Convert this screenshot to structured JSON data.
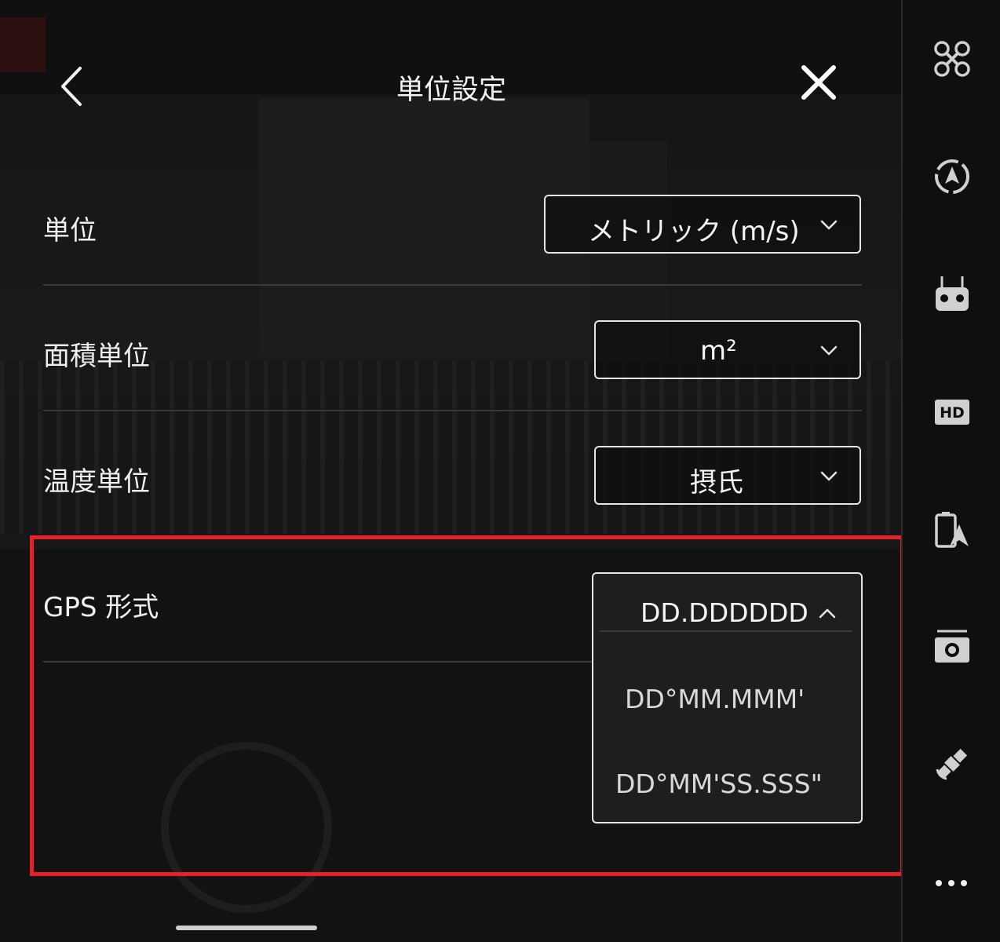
{
  "header": {
    "title": "単位設定",
    "back_icon": "chevron-left-icon",
    "close_icon": "close-icon"
  },
  "settings": {
    "units": {
      "label": "単位",
      "value": "メトリック (m/s)"
    },
    "area_units": {
      "label": "面積単位",
      "value": "m²"
    },
    "temperature_units": {
      "label": "温度単位",
      "value": "摂氏"
    },
    "gps_format": {
      "label": "GPS 形式",
      "selected": "DD.DDDDDD",
      "options": [
        "DD°MM.MMM'",
        "DD°MM'SS.SSS\""
      ]
    }
  },
  "sidebar": {
    "icons": [
      "drone-icon",
      "navigation-icon",
      "remote-controller-icon",
      "hd-icon",
      "battery-icon",
      "camera-icon",
      "satellite-icon",
      "more-icon"
    ],
    "hd_label": "HD"
  },
  "colors": {
    "highlight": "#e8202a",
    "background": "#101010",
    "border": "#e6e6e6"
  }
}
